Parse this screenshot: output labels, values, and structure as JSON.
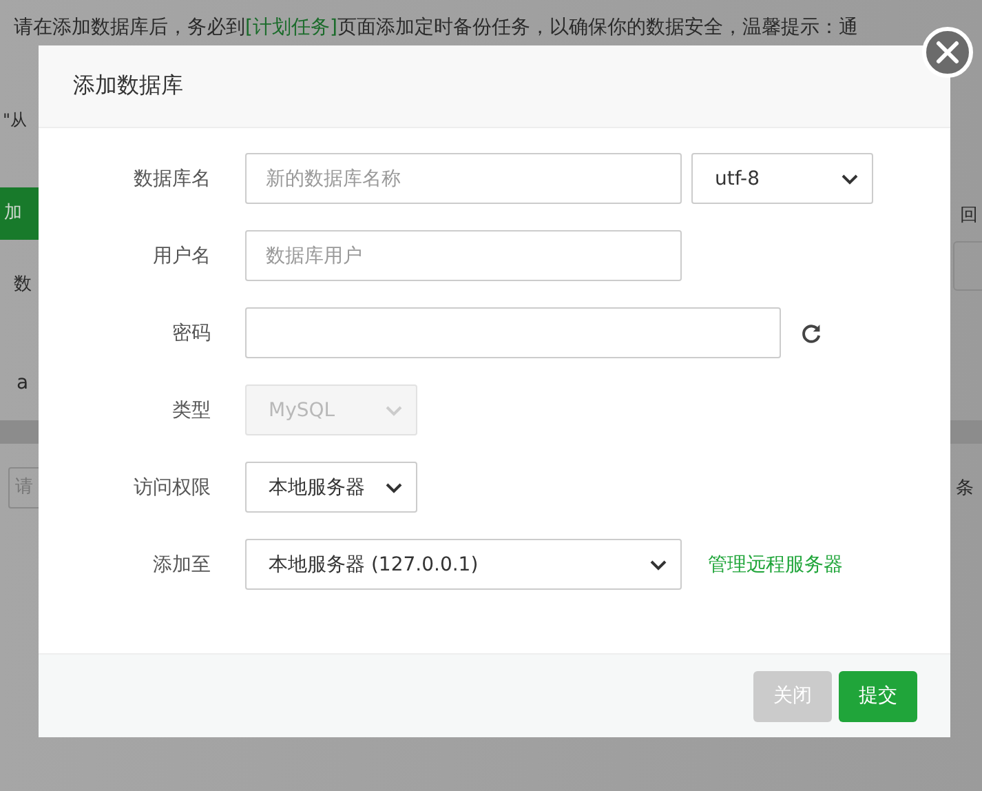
{
  "background": {
    "notice": {
      "before": "请在添加数据库后，务必到",
      "link": "[计划任务]",
      "after": "页面添加定时备份任务，以确保你的数据安全，温馨提示：通"
    },
    "left": {
      "hint": "\"从",
      "button": "加",
      "header": "数",
      "cell": "a",
      "search": "请"
    },
    "right": {
      "links": [
        "回"
      ],
      "pager": "条"
    }
  },
  "dialog": {
    "title": "添加数据库",
    "rows": [
      {
        "label": "数据库名",
        "controls": [
          {
            "kind": "input",
            "placeholder": "新的数据库名称"
          },
          {
            "kind": "select",
            "value": "utf-8",
            "disabled": false
          }
        ]
      },
      {
        "label": "用户名",
        "controls": [
          {
            "kind": "input",
            "placeholder": "数据库用户"
          }
        ]
      },
      {
        "label": "密码",
        "controls": [
          {
            "kind": "input"
          },
          {
            "kind": "refresh"
          }
        ]
      },
      {
        "label": "类型",
        "controls": [
          {
            "kind": "select",
            "value": "MySQL",
            "disabled": true
          }
        ]
      },
      {
        "label": "访问权限",
        "controls": [
          {
            "kind": "select",
            "value": "本地服务器",
            "disabled": false
          }
        ]
      },
      {
        "label": "添加至",
        "controls": [
          {
            "kind": "select",
            "value": "本地服务器 (127.0.0.1)",
            "disabled": false
          },
          {
            "kind": "link",
            "text": "管理远程服务器"
          }
        ]
      }
    ],
    "buttons": [
      {
        "label": "关闭",
        "kind": "secondary"
      },
      {
        "label": "提交",
        "kind": "primary"
      }
    ]
  }
}
